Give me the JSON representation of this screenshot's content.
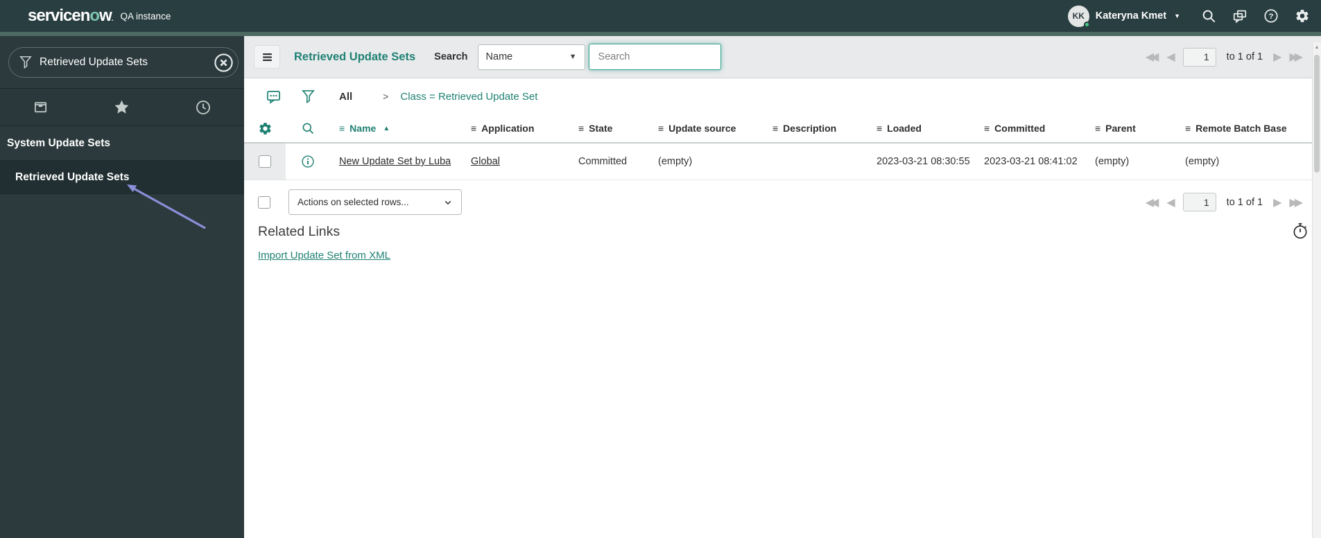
{
  "banner": {
    "logo": {
      "prefix": "servicen",
      "o": "o",
      "suffix": "w",
      "dot": "."
    },
    "instance_label": "QA instance",
    "user": {
      "initials": "KK",
      "name": "Kateryna Kmet"
    }
  },
  "sidebar": {
    "filter": {
      "value": "Retrieved Update Sets"
    },
    "tabs": [
      {
        "name": "all-applications"
      },
      {
        "name": "favorites"
      },
      {
        "name": "history"
      }
    ],
    "sections": [
      {
        "label": "System Update Sets",
        "items": [
          {
            "label": "Retrieved Update Sets",
            "selected": true
          }
        ]
      }
    ]
  },
  "list": {
    "title": "Retrieved Update Sets",
    "search_label": "Search",
    "search_field_selected": "Name",
    "search_placeholder": "Search",
    "breadcrumb": {
      "all": "All",
      "separator": ">",
      "filter": "Class = Retrieved Update Set"
    },
    "pagination": {
      "page": "1",
      "range": "to 1 of 1"
    },
    "columns": [
      {
        "label": "Name",
        "sorted": "ascending"
      },
      {
        "label": "Application"
      },
      {
        "label": "State"
      },
      {
        "label": "Update source"
      },
      {
        "label": "Description"
      },
      {
        "label": "Loaded"
      },
      {
        "label": "Committed"
      },
      {
        "label": "Parent"
      },
      {
        "label": "Remote Batch Base"
      }
    ],
    "rows": [
      {
        "name": "New Update Set by Luba",
        "application": "Global",
        "state": "Committed",
        "update_source": "(empty)",
        "description": "",
        "loaded": "2023-03-21 08:30:55",
        "committed": "2023-03-21 08:41:02",
        "parent": "(empty)",
        "remote_batch_base": "(empty)"
      }
    ],
    "actions_label": "Actions on selected rows..."
  },
  "related_links": {
    "title": "Related Links",
    "links": [
      {
        "label": "Import Update Set from XML"
      }
    ]
  },
  "icons": {
    "banner": [
      "search-icon",
      "connect-panes-icon",
      "help-icon",
      "gear-icon"
    ],
    "sidebar": [
      "funnel-icon",
      "clear-circle-icon",
      "all-apps-box-icon",
      "star-icon",
      "history-clock-icon"
    ],
    "list": [
      "hamburger-icon",
      "chat-dots-icon",
      "funnel-icon",
      "gear-icon",
      "search-icon",
      "info-circle-icon",
      "stopwatch-icon"
    ]
  },
  "colors": {
    "banner_bg": "#293e40",
    "accent_strip": "#4d6a62",
    "sidebar_bg": "#2c3a3d",
    "teal_accent": "#1f8173",
    "toolbar_bg": "#e9eaec",
    "annotation_arrow": "#8a8fd8",
    "presence_green": "#43c984"
  }
}
